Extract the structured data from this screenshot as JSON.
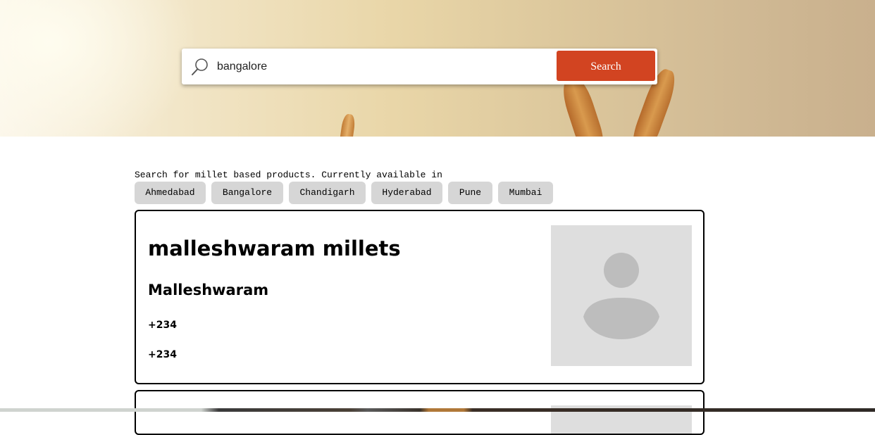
{
  "search": {
    "value": "bangalore",
    "button_label": "Search"
  },
  "intro_text": "Search for millet based products. Currently available in",
  "cities": [
    "Ahmedabad",
    "Bangalore",
    "Chandigarh",
    "Hyderabad",
    "Pune",
    "Mumbai"
  ],
  "results": [
    {
      "name": "malleshwaram millets",
      "area": "Malleshwaram",
      "phones": [
        "+234",
        "+234"
      ]
    }
  ],
  "colors": {
    "search_button": "#d24421",
    "chip_background": "#d6d6d6",
    "avatar_placeholder": "#dedede"
  }
}
